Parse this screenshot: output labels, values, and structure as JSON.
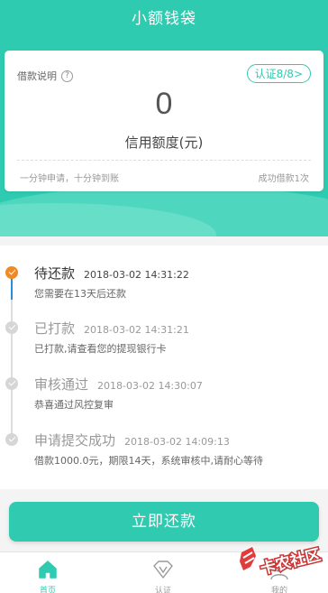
{
  "header": {
    "title": "小额钱袋"
  },
  "card": {
    "info_label": "借款说明",
    "help_glyph": "?",
    "cert_badge": "认证8/8>",
    "amount": "0",
    "amount_label": "信用额度(元)",
    "footer_left": "一分钟申请，十分钟到账",
    "footer_right": "成功借款1次"
  },
  "timeline": [
    {
      "title": "待还款",
      "time": "2018-03-02 14:31:22",
      "desc": "您需要在13天后还款",
      "active": true
    },
    {
      "title": "已打款",
      "time": "2018-03-02 14:31:21",
      "desc": "已打款,请查看您的提现银行卡",
      "active": false
    },
    {
      "title": "审核通过",
      "time": "2018-03-02 14:30:07",
      "desc": "恭喜通过风控复审",
      "active": false
    },
    {
      "title": "申请提交成功",
      "time": "2018-03-02 14:09:13",
      "desc": "借款1000.0元，期限14天，系统审核中,请耐心等待",
      "active": false
    }
  ],
  "repay_button": "立即还款",
  "tabbar": [
    {
      "label": "首页",
      "icon": "home-icon",
      "active": true
    },
    {
      "label": "认证",
      "icon": "certificate-icon",
      "active": false
    },
    {
      "label": "我的",
      "icon": "profile-icon",
      "active": false
    }
  ],
  "watermark": {
    "text": "卡农社区"
  },
  "colors": {
    "primary": "#2ecbb0",
    "active_dot": "#f08a24",
    "active_line": "#2e8bd8"
  }
}
